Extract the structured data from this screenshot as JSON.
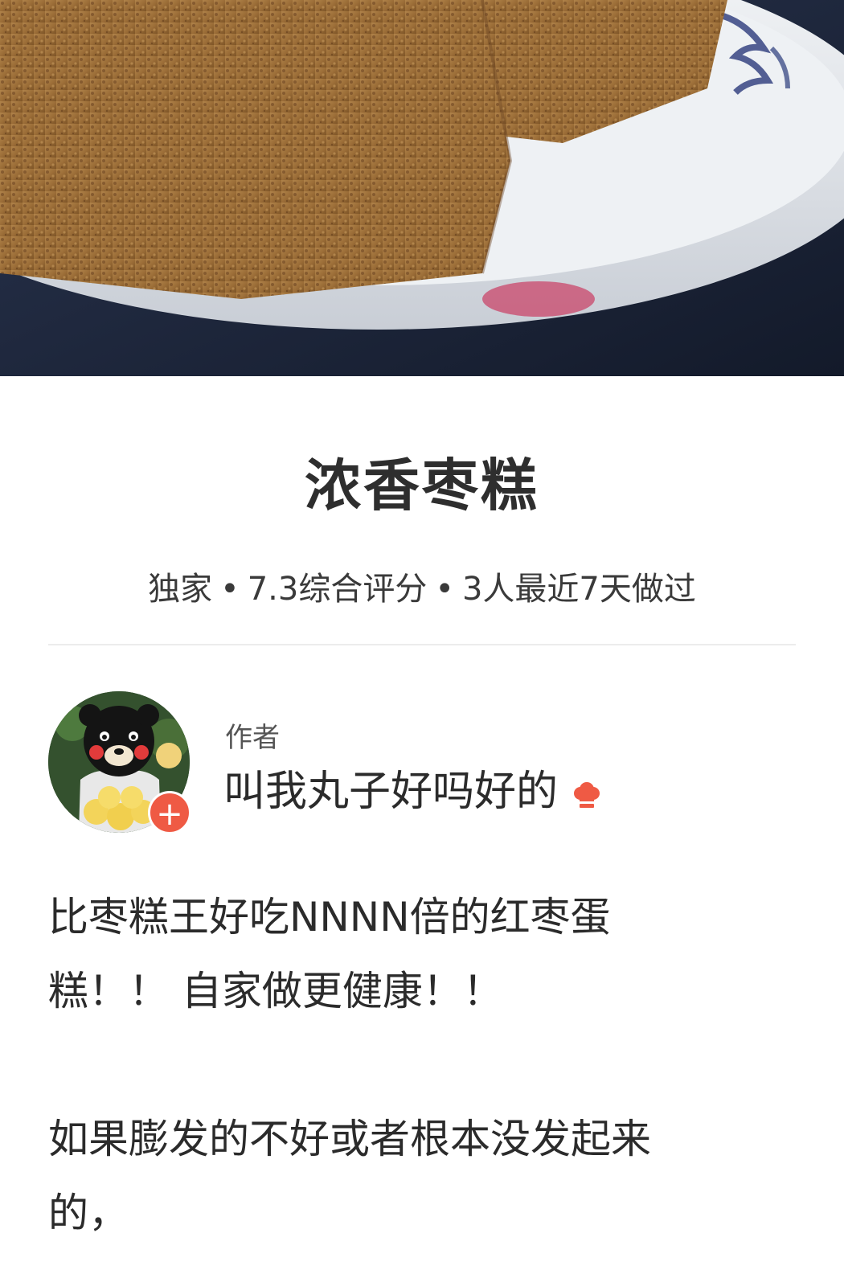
{
  "recipe": {
    "title": "浓香枣糕",
    "meta": {
      "tag": "独家",
      "rating": "7.3综合评分",
      "recent": "3人最近7天做过"
    },
    "author": {
      "label": "作者",
      "name": "叫我丸子好吗好的",
      "follow_symbol": "+"
    },
    "description": {
      "line1": "比枣糕王好吃NNNN倍的红枣蛋",
      "line2": "糕！！ 自家做更健康！！",
      "line3": "如果膨发的不好或者根本没发起来",
      "line4": "的，"
    }
  },
  "icons": {
    "chef": "chef-hat-icon",
    "follow": "plus-icon"
  },
  "colors": {
    "accent": "#ef5a44",
    "text": "#2b2b2b",
    "divider": "#ececec"
  }
}
